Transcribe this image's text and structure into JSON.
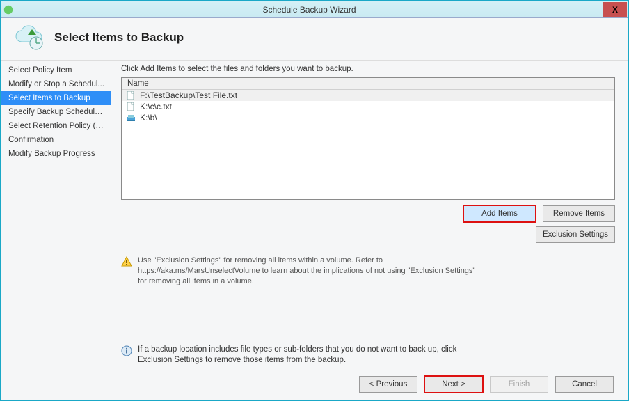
{
  "window": {
    "title": "Schedule Backup Wizard",
    "close_glyph": "X"
  },
  "header": {
    "heading": "Select Items to Backup"
  },
  "sidebar": {
    "items": [
      {
        "label": "Select Policy Item"
      },
      {
        "label": "Modify or Stop a Schedul..."
      },
      {
        "label": "Select Items to Backup"
      },
      {
        "label": "Specify Backup Schedule ..."
      },
      {
        "label": "Select Retention Policy (F..."
      },
      {
        "label": "Confirmation"
      },
      {
        "label": "Modify Backup Progress"
      }
    ],
    "active_index": 2
  },
  "main": {
    "instruction": "Click Add Items to select the files and folders you want to backup.",
    "list_header": "Name",
    "items": [
      {
        "icon": "file",
        "path": "F:\\TestBackup\\Test File.txt",
        "selected": true
      },
      {
        "icon": "file",
        "path": "K:\\c\\c.txt",
        "selected": false
      },
      {
        "icon": "folder-drive",
        "path": "K:\\b\\",
        "selected": false
      }
    ],
    "buttons": {
      "add_items": "Add Items",
      "remove_items": "Remove Items",
      "exclusion_settings": "Exclusion Settings"
    },
    "warning_text": "Use \"Exclusion Settings\" for removing all items within a volume. Refer to https://aka.ms/MarsUnselectVolume to learn about the implications of not using \"Exclusion Settings\" for removing all items in a volume.",
    "info_text": "If a backup location includes file types or sub-folders that you do not want to back up, click Exclusion Settings to remove those items from the backup."
  },
  "footer": {
    "previous": "< Previous",
    "next": "Next >",
    "finish": "Finish",
    "cancel": "Cancel"
  }
}
